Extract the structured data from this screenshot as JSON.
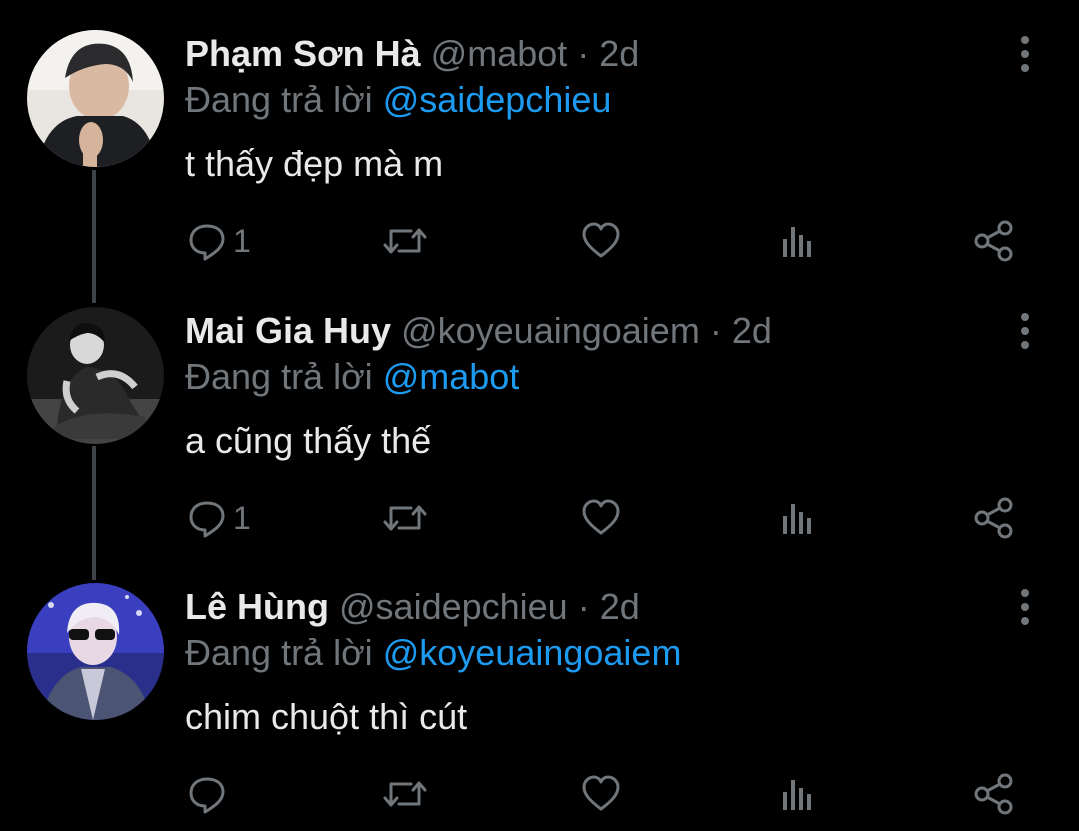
{
  "colors": {
    "background": "#000000",
    "primary_text": "#e7e9ea",
    "secondary_text": "#71767b",
    "mention": "#1d9bf0",
    "thread_line": "#3d4349"
  },
  "reply_prefix": "Đang trả lời",
  "tweets": [
    {
      "name": "Phạm Sơn Hà",
      "handle": "@mabot",
      "time": "· 2d",
      "reply_to": "@saidepchieu",
      "text": "t thấy đẹp mà m",
      "reply_count": "1",
      "actions": [
        "reply-icon",
        "retweet-icon",
        "like-icon",
        "views-icon",
        "share-icon"
      ]
    },
    {
      "name": "Mai Gia Huy",
      "handle": "@koyeuaingoaiem",
      "time": "· 2d",
      "reply_to": "@mabot",
      "text": "a cũng thấy thế",
      "reply_count": "1",
      "actions": [
        "reply-icon",
        "retweet-icon",
        "like-icon",
        "views-icon",
        "share-icon"
      ]
    },
    {
      "name": "Lê Hùng",
      "handle": "@saidepchieu",
      "time": "· 2d",
      "reply_to": "@koyeuaingoaiem",
      "text": "chim chuột thì cút",
      "reply_count": "",
      "actions": [
        "reply-icon",
        "retweet-icon",
        "like-icon",
        "views-icon",
        "share-icon"
      ]
    }
  ]
}
